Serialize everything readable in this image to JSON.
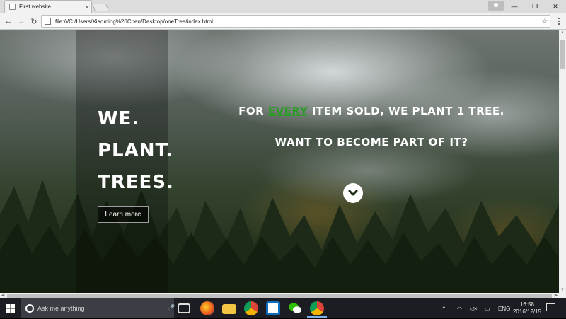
{
  "browser": {
    "tab_title": "First website",
    "tab_close": "×",
    "url": "file:///C:/Users/Xiaoming%20Chen/Desktop/oneTree/index.html",
    "window_controls": [
      "—",
      "❐",
      "✕"
    ],
    "nav": {
      "back": "←",
      "forward": "→",
      "reload": "↻",
      "star": "☆"
    }
  },
  "page": {
    "title_lines": [
      "WE.",
      "PLANT.",
      "TREES."
    ],
    "cta_label": "Learn more",
    "tagline_before": "FOR ",
    "tagline_highlight": "EVERY",
    "tagline_after": " ITEM SOLD, WE PLANT 1 TREE.",
    "subline": "WANT TO BECOME PART OF IT?",
    "colors": {
      "highlight": "#2e9a2a",
      "text": "#ffffff"
    }
  },
  "taskbar": {
    "search_placeholder": "Ask me anything",
    "apps": [
      "task-view",
      "firefox",
      "file-explorer",
      "chrome",
      "app-store",
      "wechat",
      "chrome-active"
    ],
    "tray": {
      "language": "ENG",
      "time": "16:58",
      "date": "2016/12/15"
    }
  }
}
